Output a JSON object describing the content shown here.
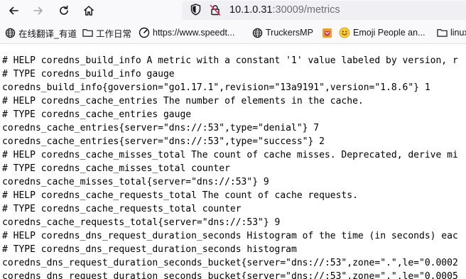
{
  "browser": {
    "url_host": "10.1.0.31",
    "url_rest": ":30009/metrics",
    "bookmarks": [
      {
        "label": "在线翻译_有道",
        "icon": "globe-icon"
      },
      {
        "label": "工作日常",
        "icon": "folder-icon"
      },
      {
        "label": "https://www.speedt...",
        "icon": "speedometer-icon"
      },
      {
        "label": "TruckersMP",
        "icon": "globe-icon"
      },
      {
        "label": "",
        "icon": "pocket-icon"
      },
      {
        "label": "Emoji People an...",
        "icon": "smiley-icon"
      },
      {
        "label": "linux",
        "icon": "folder-icon"
      }
    ]
  },
  "metrics_lines": [
    "# HELP coredns_build_info A metric with a constant '1' value labeled by version, r",
    "# TYPE coredns_build_info gauge",
    "coredns_build_info{goversion=\"go1.17.1\",revision=\"13a9191\",version=\"1.8.6\"} 1",
    "# HELP coredns_cache_entries The number of elements in the cache.",
    "# TYPE coredns_cache_entries gauge",
    "coredns_cache_entries{server=\"dns://:53\",type=\"denial\"} 7",
    "coredns_cache_entries{server=\"dns://:53\",type=\"success\"} 2",
    "# HELP coredns_cache_misses_total The count of cache misses. Deprecated, derive mi",
    "# TYPE coredns_cache_misses_total counter",
    "coredns_cache_misses_total{server=\"dns://:53\"} 9",
    "# HELP coredns_cache_requests_total The count of cache requests.",
    "# TYPE coredns_cache_requests_total counter",
    "coredns_cache_requests_total{server=\"dns://:53\"} 9",
    "# HELP coredns_dns_request_duration_seconds Histogram of the time (in seconds) eac",
    "# TYPE coredns_dns_request_duration_seconds histogram",
    "coredns_dns_request_duration_seconds_bucket{server=\"dns://:53\",zone=\".\",le=\"0.0002",
    "coredns_dns_request_duration_seconds_bucket{server=\"dns://:53\",zone=\".\",le=\"0.0005"
  ]
}
